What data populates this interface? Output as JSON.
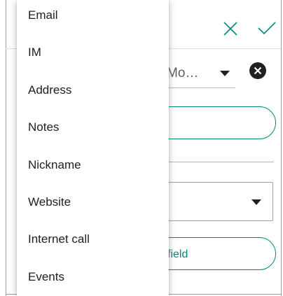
{
  "menu": {
    "items": [
      {
        "label": "Email"
      },
      {
        "label": "IM"
      },
      {
        "label": "Address"
      },
      {
        "label": "Notes"
      },
      {
        "label": "Nickname"
      },
      {
        "label": "Website"
      },
      {
        "label": "Internet call"
      },
      {
        "label": "Events"
      }
    ]
  },
  "form": {
    "phone_type": "Mo…",
    "add_field_label": "field"
  },
  "colors": {
    "accent": "#00897b",
    "divider_accent": "#80cbc4"
  },
  "icons": {
    "close": "close-icon",
    "check": "check-icon",
    "remove": "remove-circle-icon",
    "dropdown": "dropdown-arrow-icon"
  }
}
